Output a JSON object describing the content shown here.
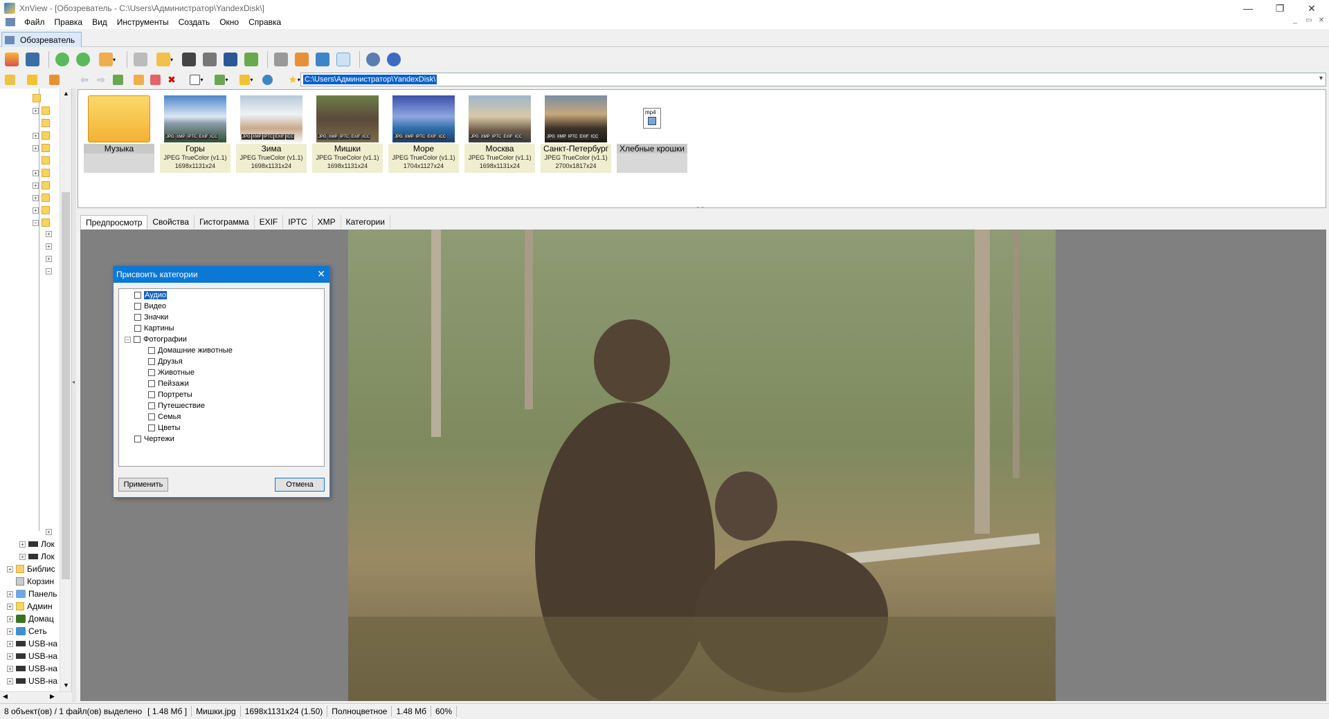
{
  "window": {
    "title": "XnView - [Обозреватель - C:\\Users\\Администратор\\YandexDisk\\]",
    "minimize": "—",
    "maximize": "❐",
    "close": "✕"
  },
  "menu": {
    "items": [
      "Файл",
      "Правка",
      "Вид",
      "Инструменты",
      "Создать",
      "Окно",
      "Справка"
    ],
    "mdi_controls": [
      "_",
      "▭",
      "✕"
    ]
  },
  "doc_tab": {
    "label": "Обозреватель"
  },
  "address": {
    "path": "C:\\Users\\Администратор\\YandexDisk\\"
  },
  "tree": {
    "bottom_items": [
      {
        "label": "Лок",
        "icon": "drive-icon"
      },
      {
        "label": "Лок",
        "icon": "drive-icon"
      },
      {
        "label": "Библис",
        "icon": "library-icon"
      },
      {
        "label": "Корзин",
        "icon": "trash-icon"
      },
      {
        "label": "Панель",
        "icon": "control-panel-icon"
      },
      {
        "label": "Админ",
        "icon": "user-icon"
      },
      {
        "label": "Домац",
        "icon": "homegroup-icon"
      },
      {
        "label": "Сеть",
        "icon": "network-icon"
      },
      {
        "label": "USB-на",
        "icon": "usb-drive-icon"
      },
      {
        "label": "USB-на",
        "icon": "usb-drive-icon"
      },
      {
        "label": "USB-на",
        "icon": "usb-drive-icon"
      },
      {
        "label": "USB-на",
        "icon": "usb-drive-icon"
      }
    ]
  },
  "thumbnails": [
    {
      "name": "Музыка",
      "type": "folder",
      "meta1": "",
      "meta2": ""
    },
    {
      "name": "Горы",
      "type": "image",
      "meta1": "JPEG TrueColor (v1.1)",
      "meta2": "1698x1131x24"
    },
    {
      "name": "Зима",
      "type": "image",
      "meta1": "JPEG TrueColor (v1.1)",
      "meta2": "1698x1131x24"
    },
    {
      "name": "Мишки",
      "type": "image",
      "meta1": "JPEG TrueColor (v1.1)",
      "meta2": "1698x1131x24"
    },
    {
      "name": "Море",
      "type": "image",
      "meta1": "JPEG TrueColor (v1.1)",
      "meta2": "1704x1127x24"
    },
    {
      "name": "Москва",
      "type": "image",
      "meta1": "JPEG TrueColor (v1.1)",
      "meta2": "1698x1131x24"
    },
    {
      "name": "Санкт-Петербург",
      "type": "image",
      "meta1": "JPEG TrueColor (v1.1)",
      "meta2": "2700x1817x24"
    },
    {
      "name": "Хлебные крошки",
      "type": "video",
      "meta1": "",
      "meta2": ""
    }
  ],
  "badges": [
    "JPG",
    "XMP",
    "IPTC",
    "EXIF",
    "ICC"
  ],
  "video_badge": "mp4",
  "preview_tabs": [
    "Предпросмотр",
    "Свойства",
    "Гистограмма",
    "EXIF",
    "IPTC",
    "XMP",
    "Категории"
  ],
  "dialog": {
    "title": "Присвоить категории",
    "categories": [
      {
        "label": "Аудио",
        "level": 0,
        "selected": true
      },
      {
        "label": "Видео",
        "level": 0
      },
      {
        "label": "Значки",
        "level": 0
      },
      {
        "label": "Картины",
        "level": 0
      },
      {
        "label": "Фотографии",
        "level": 0,
        "expanded": true
      },
      {
        "label": "Домашние животные",
        "level": 1
      },
      {
        "label": "Друзья",
        "level": 1
      },
      {
        "label": "Животные",
        "level": 1
      },
      {
        "label": "Пейзажи",
        "level": 1
      },
      {
        "label": "Портреты",
        "level": 1
      },
      {
        "label": "Путешествие",
        "level": 1
      },
      {
        "label": "Семья",
        "level": 1
      },
      {
        "label": "Цветы",
        "level": 1
      },
      {
        "label": "Чертежи",
        "level": 0
      }
    ],
    "apply_label": "Применить",
    "cancel_label": "Отмена"
  },
  "status": {
    "count": "8 объект(ов) / 1 файл(ов) выделено",
    "size": "[ 1.48 Мб ]",
    "filename": "Мишки.jpg",
    "dims": "1698x1131x24 (1.50)",
    "color": "Полноцветное",
    "filesize": "1.48 Мб",
    "zoom": "60%"
  }
}
